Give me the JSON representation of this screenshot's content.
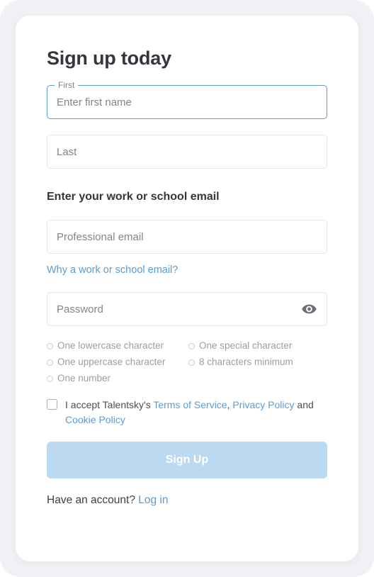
{
  "page": {
    "title": "Sign up today"
  },
  "colors": {
    "accent_link": "#5b9bd5",
    "submit_bg": "#bcd9f2",
    "focus_border": "#5b9bd5",
    "card_bg": "#ffffff",
    "shell_bg": "#eff1f4"
  },
  "fields": {
    "first": {
      "label": "First",
      "placeholder": "Enter first name",
      "value": ""
    },
    "last": {
      "placeholder": "Last",
      "value": ""
    },
    "email": {
      "placeholder": "Professional email",
      "value": ""
    },
    "password": {
      "placeholder": "Password",
      "value": "",
      "toggle_icon": "eye-icon"
    }
  },
  "email_section": {
    "heading": "Enter your work or school email",
    "help_link": "Why a work or school email?"
  },
  "password_requirements": [
    "One lowercase character",
    "One special character",
    "One uppercase character",
    "8 characters minimum",
    "One number"
  ],
  "terms": {
    "prefix": "I accept Talentsky's ",
    "link_terms": "Terms of Service",
    "separator_1": ", ",
    "link_privacy": "Privacy Policy",
    "conjunction": " and ",
    "link_cookie": "Cookie Policy",
    "checked": false
  },
  "submit": {
    "label": "Sign Up"
  },
  "footer": {
    "prompt": "Have an account? ",
    "login_label": "Log in"
  }
}
